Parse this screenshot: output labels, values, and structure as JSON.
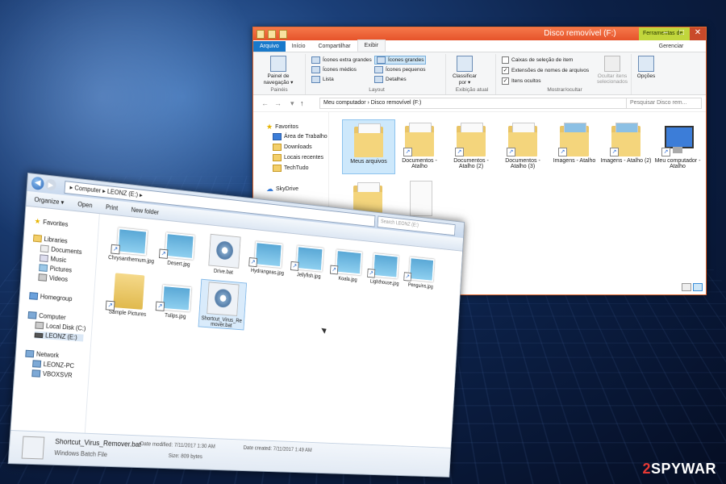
{
  "background": {
    "accent": "#0c2148",
    "brand_name_a": "2",
    "brand_name_b": "SPYWAR"
  },
  "win8": {
    "title": "Disco removível (F:)",
    "context_tab": "Ferramentas de Unidade",
    "tabs": [
      "Arquivo",
      "Início",
      "Compartilhar",
      "Exibir",
      "Gerenciar"
    ],
    "ribbon": {
      "panes_btn": "Painel de navegação ▾",
      "group_panes": "Painéis",
      "layout": [
        "Ícones extra grandes",
        "Ícones grandes",
        "Ícones médios",
        "Ícones pequenos",
        "Lista",
        "Detalhes"
      ],
      "group_layout": "Layout",
      "sort_btn": "Classificar por ▾",
      "group_current": "Exibição atual",
      "checks": [
        "Caixas de seleção de item",
        "Extensões de nomes de arquivos",
        "Itens ocultos"
      ],
      "checks_state": [
        false,
        true,
        true
      ],
      "hide_btn": "Ocultar itens selecionados",
      "group_showhide": "Mostrar/ocultar",
      "options_btn": "Opções"
    },
    "address": "Meu computador › Disco removível (F:)",
    "search_placeholder": "Pesquisar Disco rem...",
    "nav": [
      "Favoritos",
      "Área de Trabalho",
      "Downloads",
      "Locais recentes",
      "TechTudo",
      "SkyDrive"
    ],
    "items": [
      "Meus arquivos",
      "Documentos - Atalho",
      "Documentos - Atalho (2)",
      "Documentos - Atalho (3)",
      "Imagens - Atalho",
      "Imagens - Atalho (2)",
      "Meu computador - Atalho"
    ]
  },
  "win7": {
    "address": "▸ Computer ▸ LEONZ (E:) ▸",
    "search_placeholder": "Search LEONZ (E:)",
    "commands": [
      "Organize ▾",
      "Open",
      "Print",
      "New folder"
    ],
    "nav": [
      "Favorites",
      "Libraries",
      "Documents",
      "Music",
      "Pictures",
      "Videos",
      "Homegroup",
      "Computer",
      "Local Disk (C:)",
      "LEONZ (E:)",
      "Network",
      "LEONZ-PC",
      "VBOXSVR"
    ],
    "items": [
      "Chrysanthemum.jpg",
      "Desert.jpg",
      "Drive.bat",
      "Hydrangeas.jpg",
      "Jellyfish.jpg",
      "Koala.jpg",
      "Lighthouse.jpg",
      "Penguins.jpg",
      "Sample Pictures",
      "Tulips.jpg",
      "Shortcut_Virus_Remover.bat"
    ],
    "details": {
      "name": "Shortcut_Virus_Remover.bat",
      "type": "Windows Batch File",
      "modified": "Date modified: 7/11/2017 1:30 AM",
      "size": "Size: 809 bytes",
      "created": "Date created: 7/11/2017 1:49 AM"
    }
  }
}
